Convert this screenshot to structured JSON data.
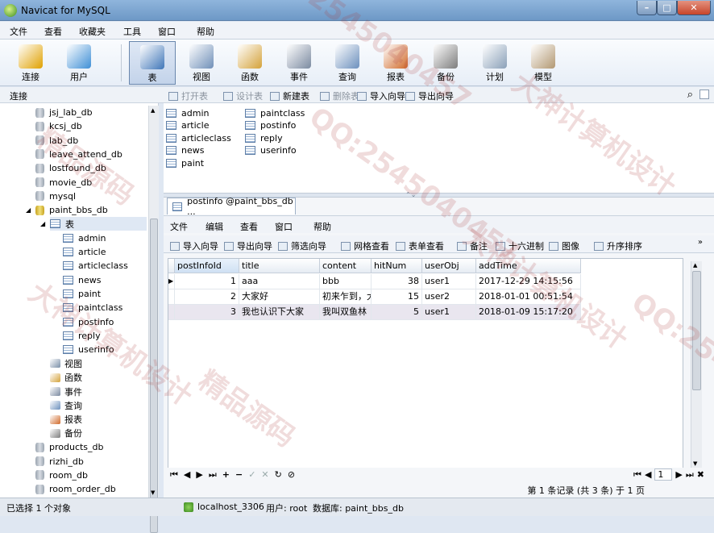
{
  "window": {
    "title": "Navicat for MySQL"
  },
  "menu": [
    "文件",
    "查看",
    "收藏夹",
    "工具",
    "窗口",
    "帮助"
  ],
  "toolbar": [
    {
      "label": "连接",
      "icon": "connection-icon",
      "color": "#e0a100"
    },
    {
      "label": "用户",
      "icon": "user-icon",
      "color": "#3e8fd6"
    },
    {
      "label": "表",
      "icon": "table-icon",
      "color": "#3f76b8"
    },
    {
      "label": "视图",
      "icon": "view-icon",
      "color": "#6f8fb8"
    },
    {
      "label": "函数",
      "icon": "function-icon",
      "color": "#d4a23a"
    },
    {
      "label": "事件",
      "icon": "event-icon",
      "color": "#7b8aa0"
    },
    {
      "label": "查询",
      "icon": "query-icon",
      "color": "#6c90bd"
    },
    {
      "label": "报表",
      "icon": "report-icon",
      "color": "#d06a2a"
    },
    {
      "label": "备份",
      "icon": "backup-icon",
      "color": "#7d7d7d"
    },
    {
      "label": "计划",
      "icon": "schedule-icon",
      "color": "#8aa0b8"
    },
    {
      "label": "模型",
      "icon": "model-icon",
      "color": "#b29872"
    }
  ],
  "connection_label": "连接",
  "tree": {
    "dbs_before": [
      "jsj_lab_db",
      "kcsj_db",
      "lab_db",
      "leave_attend_db",
      "lostfound_db",
      "movie_db",
      "mysql"
    ],
    "open_db": "paint_bbs_db",
    "tables_node": "表",
    "tables": [
      "admin",
      "article",
      "articleclass",
      "news",
      "paint",
      "paintclass",
      "postinfo",
      "reply",
      "userinfo"
    ],
    "other_nodes": [
      {
        "label": "视图",
        "icon": "view-icon"
      },
      {
        "label": "函数",
        "icon": "function-icon"
      },
      {
        "label": "事件",
        "icon": "event-icon"
      },
      {
        "label": "查询",
        "icon": "query-icon"
      },
      {
        "label": "报表",
        "icon": "report-icon"
      },
      {
        "label": "备份",
        "icon": "backup-icon"
      }
    ],
    "dbs_after": [
      "products_db",
      "rizhi_db",
      "room_db",
      "room_order_db"
    ]
  },
  "object_toolbar": [
    {
      "label": "打开表",
      "enabled": false
    },
    {
      "label": "设计表",
      "enabled": false
    },
    {
      "label": "新建表",
      "enabled": true
    },
    {
      "label": "删除表",
      "enabled": false
    },
    {
      "label": "导入向导",
      "enabled": true
    },
    {
      "label": "导出向导",
      "enabled": true
    }
  ],
  "object_list": [
    "admin",
    "article",
    "articleclass",
    "news",
    "paint",
    "paintclass",
    "postinfo",
    "reply",
    "userinfo"
  ],
  "subwindow": {
    "tab_title": "postinfo @paint_bbs_db ...",
    "menu": [
      "文件",
      "编辑",
      "查看",
      "窗口",
      "帮助"
    ],
    "toolbar": [
      "导入向导",
      "导出向导",
      "筛选向导",
      "网格查看",
      "表单查看",
      "备注",
      "十六进制",
      "图像",
      "升序排序"
    ],
    "columns": [
      "postInfoId",
      "title",
      "content",
      "hitNum",
      "userObj",
      "addTime"
    ],
    "rows": [
      [
        "1",
        "aaa",
        "bbb",
        "38",
        "user1",
        "2017-12-29 14:15:56"
      ],
      [
        "2",
        "大家好",
        "初来乍到，大",
        "15",
        "user2",
        "2018-01-01 00:51:54"
      ],
      [
        "3",
        "我也认识下大家",
        "我叫双鱼林",
        "5",
        "user1",
        "2018-01-09 15:17:20"
      ]
    ],
    "page_number": "1",
    "record_info": "第 1 条记录 (共 3 条) 于 1 页"
  },
  "status": {
    "selected": "已选择 1 个对象",
    "connection": "localhost_3306",
    "user": "用户: root",
    "database": "数据库: paint_bbs_db"
  },
  "watermarks": [
    "QQ:2545040457",
    "大神计算机设计",
    "精品源码",
    "QQ:2545040457",
    "大神计算机设计",
    "QQ:2545040457",
    "精品源码",
    "大神计算机设计"
  ]
}
